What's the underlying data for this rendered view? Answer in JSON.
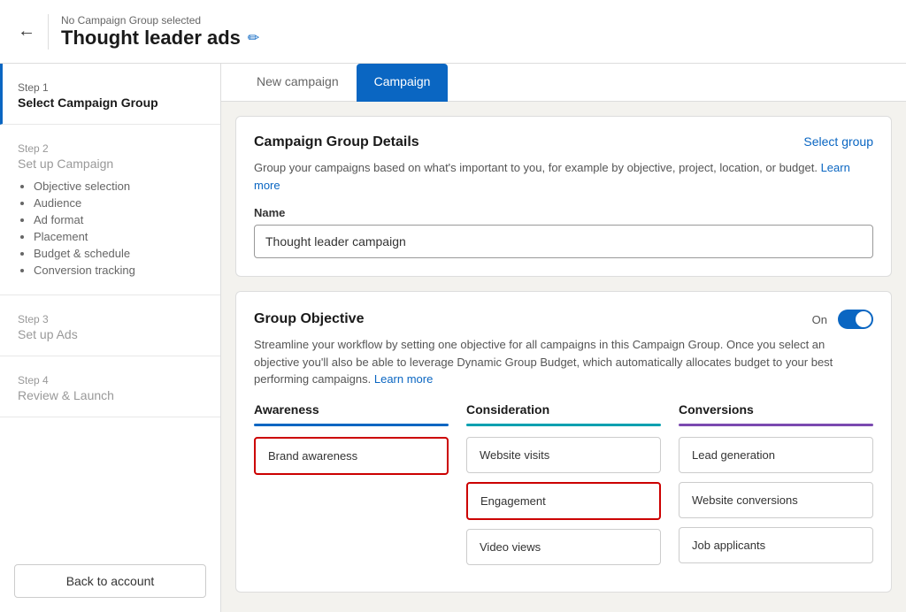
{
  "header": {
    "no_group_text": "No Campaign Group selected",
    "title": "Thought leader ads",
    "edit_icon": "✏"
  },
  "sidebar": {
    "steps": [
      {
        "id": "step1",
        "step_label": "Step 1",
        "title": "Select Campaign Group",
        "active": true,
        "subitems": []
      },
      {
        "id": "step2",
        "step_label": "Step 2",
        "title": "Set up Campaign",
        "active": false,
        "subitems": [
          "Objective selection",
          "Audience",
          "Ad format",
          "Placement",
          "Budget & schedule",
          "Conversion tracking"
        ]
      },
      {
        "id": "step3",
        "step_label": "Step 3",
        "title": "Set up Ads",
        "active": false,
        "subitems": []
      },
      {
        "id": "step4",
        "step_label": "Step 4",
        "title": "Review & Launch",
        "active": false,
        "subitems": []
      }
    ],
    "back_button": "Back to account"
  },
  "tabs": [
    {
      "label": "New campaign",
      "active": false
    },
    {
      "label": "Campaign",
      "active": true
    }
  ],
  "campaign_group_card": {
    "title": "Campaign Group Details",
    "select_group": "Select group",
    "description": "Group your campaigns based on what's important to you, for example by objective, project, location, or budget.",
    "learn_more": "Learn more",
    "name_label": "Name",
    "name_value": "Thought leader campaign",
    "name_placeholder": "Thought leader campaign"
  },
  "group_objective_card": {
    "title": "Group Objective",
    "toggle_label": "On",
    "description": "Streamline your workflow by setting one objective for all campaigns in this Campaign Group. Once you select an objective you'll also be able to leverage Dynamic Group Budget, which automatically allocates budget to your best performing campaigns.",
    "learn_more": "Learn more",
    "columns": [
      {
        "id": "awareness",
        "title": "Awareness",
        "bar_class": "bar-blue",
        "options": [
          {
            "id": "brand-awareness",
            "label": "Brand awareness",
            "selected_red": true
          }
        ]
      },
      {
        "id": "consideration",
        "title": "Consideration",
        "bar_class": "bar-teal",
        "options": [
          {
            "id": "website-visits",
            "label": "Website visits",
            "selected_red": false
          },
          {
            "id": "engagement",
            "label": "Engagement",
            "selected_red": true
          },
          {
            "id": "video-views",
            "label": "Video views",
            "selected_red": false
          }
        ]
      },
      {
        "id": "conversions",
        "title": "Conversions",
        "bar_class": "bar-purple",
        "options": [
          {
            "id": "lead-generation",
            "label": "Lead generation",
            "selected_red": false
          },
          {
            "id": "website-conversions",
            "label": "Website conversions",
            "selected_red": false
          },
          {
            "id": "job-applicants",
            "label": "Job applicants",
            "selected_red": false
          }
        ]
      }
    ]
  }
}
